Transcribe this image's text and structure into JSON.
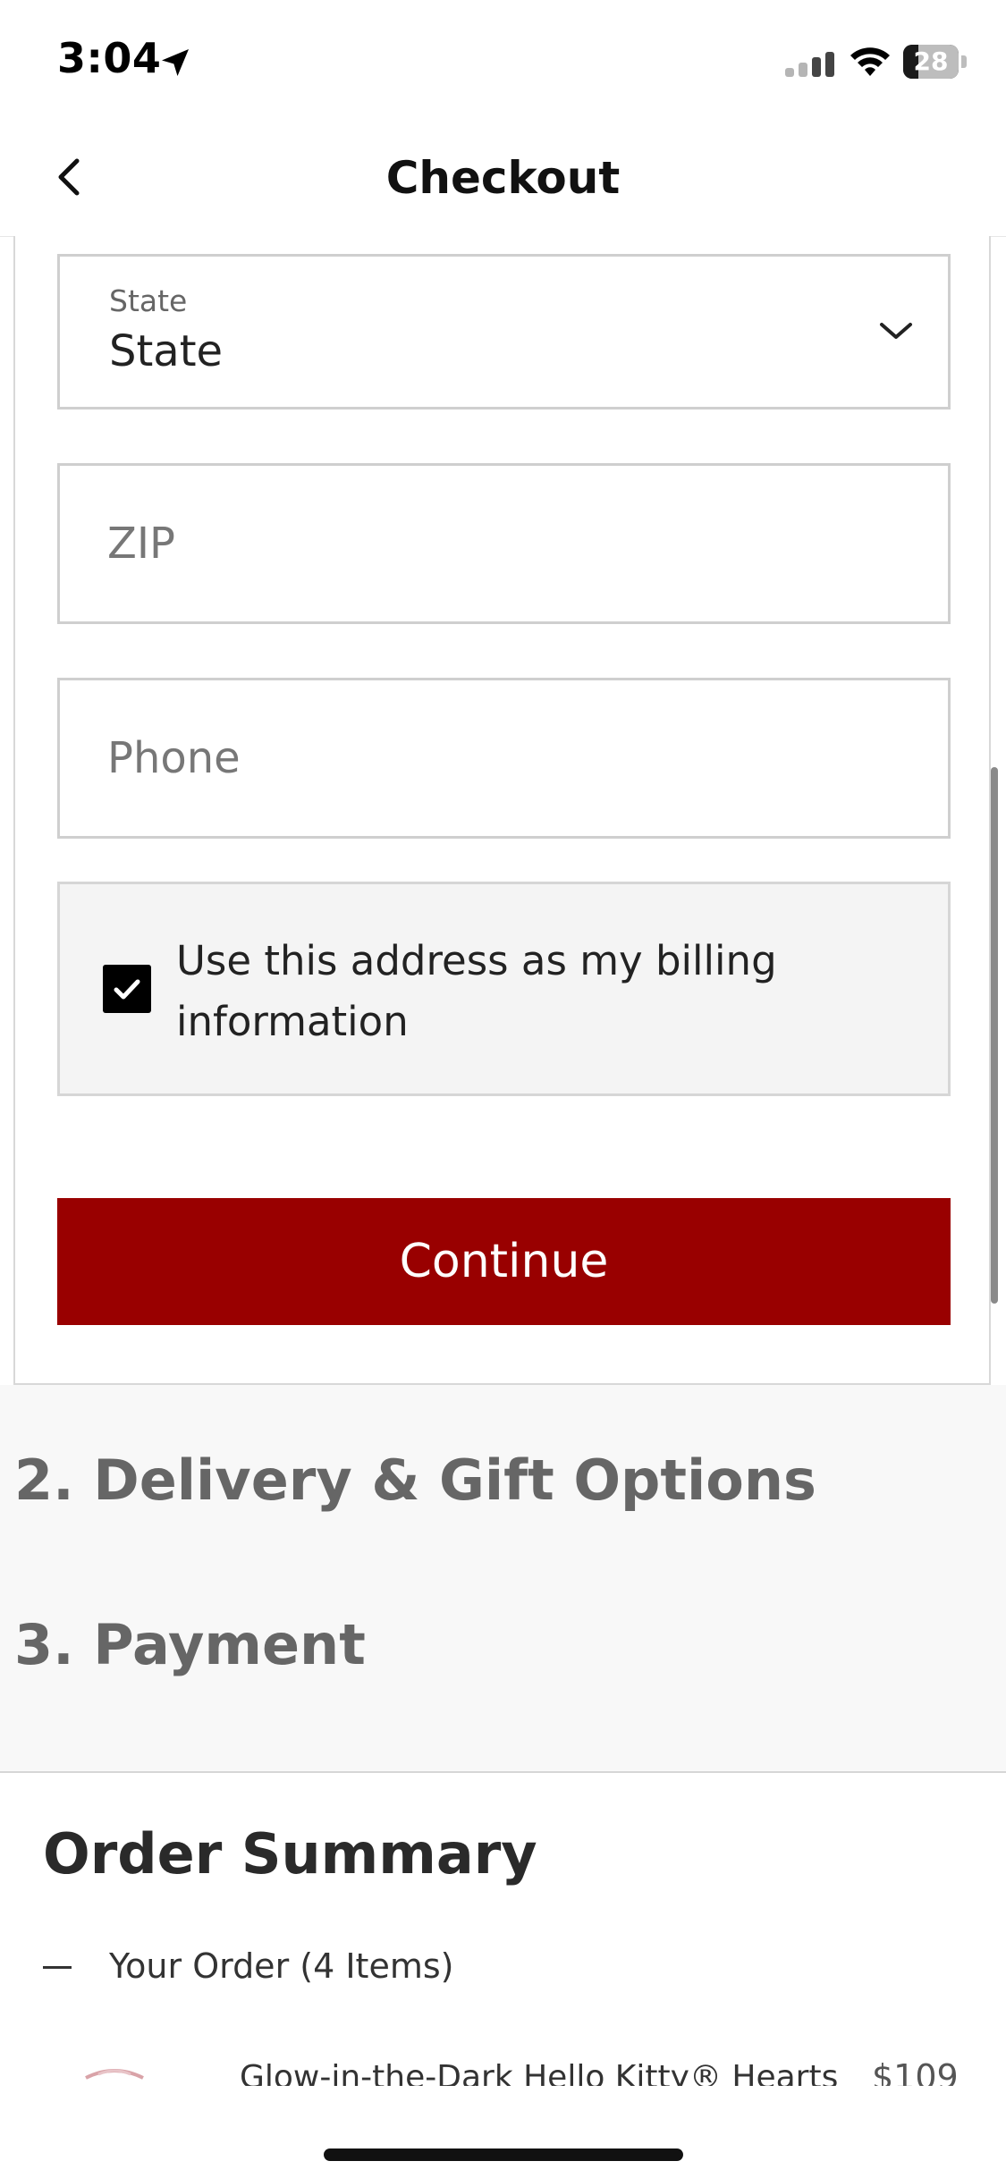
{
  "status_bar": {
    "time": "3:04",
    "battery": "28",
    "battery_level": 0.28
  },
  "nav": {
    "title": "Checkout"
  },
  "address_form": {
    "state": {
      "label": "State",
      "value": "State"
    },
    "zip": {
      "placeholder": "ZIP",
      "value": ""
    },
    "phone": {
      "placeholder": "Phone",
      "value": ""
    },
    "billing_checkbox": {
      "label": "Use this address as my billing information",
      "checked": true
    },
    "continue_label": "Continue",
    "continue_color": "#990000"
  },
  "steps": [
    {
      "label": "2. Delivery & Gift Options"
    },
    {
      "label": "3. Payment"
    }
  ],
  "order_summary": {
    "title": "Order Summary",
    "toggle_label": "Your Order (4 Items)",
    "items": [
      {
        "name": "Glow-in-the-Dark Hello Kitty® Hearts",
        "price": "$109"
      }
    ]
  },
  "icons": {
    "location": "location-arrow-icon",
    "signal": "cellular-signal-icon",
    "wifi": "wifi-icon",
    "battery": "battery-icon",
    "back": "chevron-left-icon",
    "dropdown": "chevron-down-icon",
    "check": "checkmark-icon",
    "collapse": "minus-icon"
  }
}
